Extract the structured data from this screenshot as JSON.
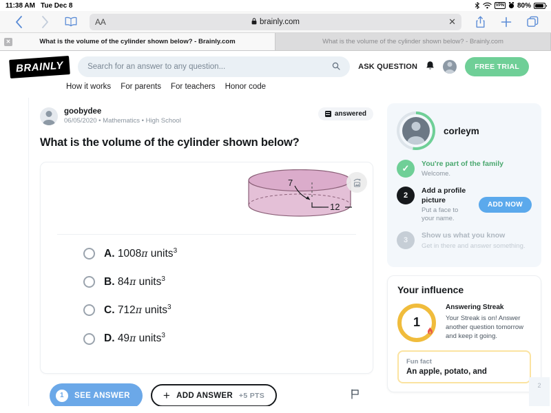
{
  "status_bar": {
    "time": "11:38 AM",
    "date": "Tue Dec 8",
    "vpn_label": "VPN",
    "battery_percent": "80%",
    "icons": [
      "bluetooth-icon",
      "wifi-icon",
      "vpn-icon",
      "alarm-icon",
      "battery-icon"
    ]
  },
  "browser": {
    "back_icon": "chevron-left-icon",
    "forward_icon": "chevron-right-icon",
    "bookmarks_icon": "book-icon",
    "text_size_label": "AA",
    "url": "brainly.com",
    "lock_icon": "lock-icon",
    "clear_label": "✕",
    "share_icon": "share-icon",
    "new_tab_label": "+",
    "tabs_icon": "tabs-icon",
    "tabs": [
      {
        "title": "What is the volume of the cylinder shown below? - Brainly.com",
        "active": true,
        "close_label": "✕"
      },
      {
        "title": "What is the volume of the cylinder shown below? - Brainly.com",
        "active": false
      }
    ]
  },
  "site_header": {
    "logo_text": "BRAINLY",
    "search_placeholder": "Search for an answer to any question...",
    "search_value": "",
    "search_icon": "search-icon",
    "ask_question_label": "ASK QUESTION",
    "notifications_icon": "bell-icon",
    "profile_icon": "avatar-icon",
    "free_trial_label": "FREE TRIAL",
    "nav_links": [
      "How it works",
      "For parents",
      "For teachers",
      "Honor code"
    ]
  },
  "question": {
    "author": "goobydee",
    "meta": "06/05/2020 • Mathematics • High School",
    "status_badge": "answered",
    "status_icon": "answered-icon",
    "title": "What is the volume of the cylinder shown below?",
    "figure": {
      "shape": "cylinder",
      "radius_label": "7",
      "height_label": "12",
      "fill_color": "#d9a7c7",
      "stroke_color": "#8a5f77",
      "expand_icon": "expand-image-icon"
    },
    "options": [
      {
        "letter": "A.",
        "value": "1008",
        "symbol": "π",
        "units": " units",
        "exponent": "3"
      },
      {
        "letter": "B.",
        "value": "84",
        "symbol": "π",
        "units": " units",
        "exponent": "3"
      },
      {
        "letter": "C.",
        "value": "712",
        "symbol": "π",
        "units": " units",
        "exponent": "3"
      },
      {
        "letter": "D.",
        "value": "49",
        "symbol": "π",
        "units": " units",
        "exponent": "3"
      }
    ]
  },
  "actions": {
    "see_answer_label": "SEE ANSWER",
    "see_answer_count": "1",
    "add_answer_label": "ADD ANSWER",
    "add_answer_plus": "+",
    "add_answer_points": "+5 PTS",
    "flag_icon": "flag-icon"
  },
  "sidebar": {
    "profile": {
      "username": "corleym",
      "avatar_icon": "avatar-icon",
      "progress_color": "#6fcf97"
    },
    "steps": [
      {
        "number": "✓",
        "state": "done",
        "title": "You're part of the family",
        "subtitle": "Welcome.",
        "button": null
      },
      {
        "number": "2",
        "state": "active",
        "title": "Add a profile picture",
        "subtitle": "Put a face to your name.",
        "button": "ADD NOW"
      },
      {
        "number": "3",
        "state": "idle",
        "title": "Show us what you know",
        "subtitle": "Get in there and answer something.",
        "button": null
      }
    ],
    "influence": {
      "title": "Your influence",
      "streak_count": "1",
      "streak_icon": "flame-icon",
      "streak_ring_color": "#f0bc3c",
      "streak_heading": "Answering Streak",
      "streak_text": "Your Streak is on! Answer another question tomorrow and keep it going."
    },
    "fun_fact": {
      "label": "Fun fact",
      "text": "An apple, potato, and"
    },
    "page_marker": "2"
  }
}
